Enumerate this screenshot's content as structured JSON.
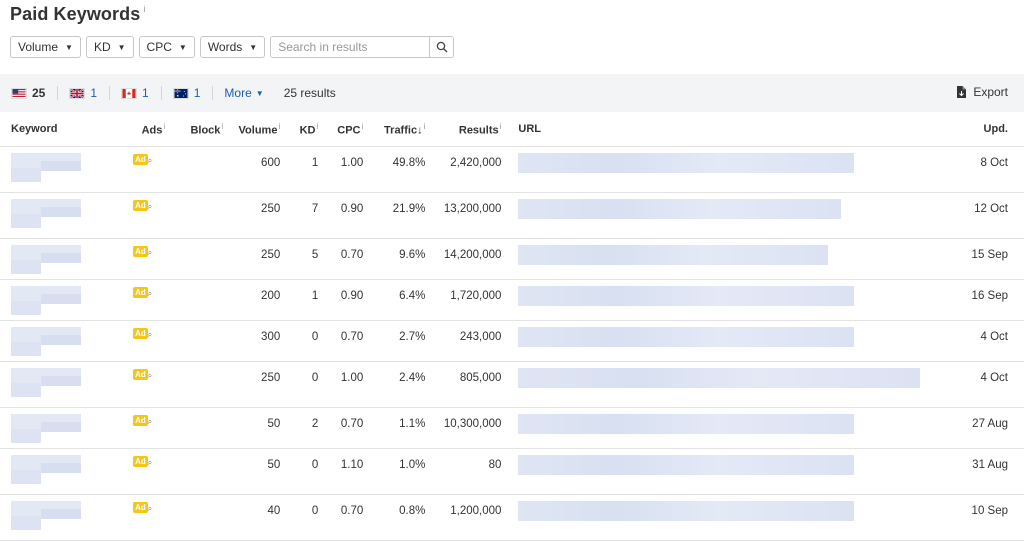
{
  "header": {
    "title": "Paid Keywords",
    "info": "i"
  },
  "filters": {
    "buttons": [
      "Volume",
      "KD",
      "CPC",
      "Words"
    ],
    "search_placeholder": "Search in results"
  },
  "toolbar": {
    "countries": [
      {
        "flag": "us-flag",
        "count": "25"
      },
      {
        "flag": "uk-flag",
        "count": "1"
      },
      {
        "flag": "ca-flag",
        "count": "1"
      },
      {
        "flag": "au-flag",
        "count": "1"
      }
    ],
    "more_label": "More",
    "results": "25 results",
    "export_label": "Export"
  },
  "table": {
    "headers": {
      "keyword": "Keyword",
      "ads": "Ads",
      "block": "Block",
      "volume": "Volume",
      "kd": "KD",
      "cpc": "CPC",
      "traffic": "Traffic",
      "results": "Results",
      "url": "URL",
      "upd": "Upd."
    },
    "info_marker": "i",
    "sort_arrow": "↓",
    "ad_badge": "Ad",
    "rows": [
      {
        "volume": "600",
        "kd": "1",
        "cpc": "1.00",
        "traffic": "49.8%",
        "results": "2,420,000",
        "upd": "8 Oct"
      },
      {
        "volume": "250",
        "kd": "7",
        "cpc": "0.90",
        "traffic": "21.9%",
        "results": "13,200,000",
        "upd": "12 Oct"
      },
      {
        "volume": "250",
        "kd": "5",
        "cpc": "0.70",
        "traffic": "9.6%",
        "results": "14,200,000",
        "upd": "15 Sep"
      },
      {
        "volume": "200",
        "kd": "1",
        "cpc": "0.90",
        "traffic": "6.4%",
        "results": "1,720,000",
        "upd": "16 Sep"
      },
      {
        "volume": "300",
        "kd": "0",
        "cpc": "0.70",
        "traffic": "2.7%",
        "results": "243,000",
        "upd": "4 Oct"
      },
      {
        "volume": "250",
        "kd": "0",
        "cpc": "1.00",
        "traffic": "2.4%",
        "results": "805,000",
        "upd": "4 Oct"
      },
      {
        "volume": "50",
        "kd": "2",
        "cpc": "0.70",
        "traffic": "1.1%",
        "results": "10,300,000",
        "upd": "27 Aug"
      },
      {
        "volume": "50",
        "kd": "0",
        "cpc": "1.10",
        "traffic": "1.0%",
        "results": "80",
        "upd": "31 Aug"
      },
      {
        "volume": "40",
        "kd": "0",
        "cpc": "0.70",
        "traffic": "0.8%",
        "results": "1,200,000",
        "upd": "10 Sep"
      }
    ]
  },
  "colors": {
    "accent_link": "#1a5fb4",
    "ad_badge": "#f5c518",
    "toolbar_bg": "#f3f4f6"
  }
}
